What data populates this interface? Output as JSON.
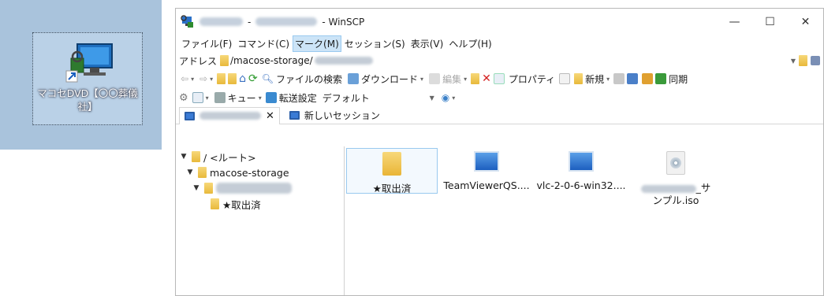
{
  "desktop": {
    "shortcut_label": "マコセDVD【〇〇葬儀社】"
  },
  "window": {
    "title_separator": "-",
    "title_app": "- WinSCP",
    "controls": {
      "minimize": "—",
      "maximize": "☐",
      "close": "✕"
    }
  },
  "menu": {
    "items": [
      "ファイル(F)",
      "コマンド(C)",
      "マーク(M)",
      "セッション(S)",
      "表示(V)",
      "ヘルプ(H)"
    ]
  },
  "address": {
    "label": "アドレス",
    "path": "/macose-storage/"
  },
  "toolbar1": {
    "find_files": "ファイルの検索",
    "download": "ダウンロード",
    "edit": "編集",
    "properties": "プロパティ",
    "new": "新規",
    "sync": "同期"
  },
  "toolbar2": {
    "queue": "キュー",
    "transfer_settings_label": "転送設定",
    "transfer_settings_value": "デフォルト"
  },
  "tabs": {
    "close": "✕",
    "new_session": "新しいセッション"
  },
  "tree": {
    "root": "/ <ルート>",
    "storage": "macose-storage",
    "done_folder": "★取出済"
  },
  "files": [
    {
      "name": "★取出済",
      "type": "folder-icon"
    },
    {
      "name": "TeamViewerQS....",
      "type": "app-icon"
    },
    {
      "name": "vlc-2-0-6-win32....",
      "type": "app-icon"
    },
    {
      "name": "_サ",
      "name_line2": "ンプル.iso",
      "type": "disc-image-icon"
    }
  ]
}
